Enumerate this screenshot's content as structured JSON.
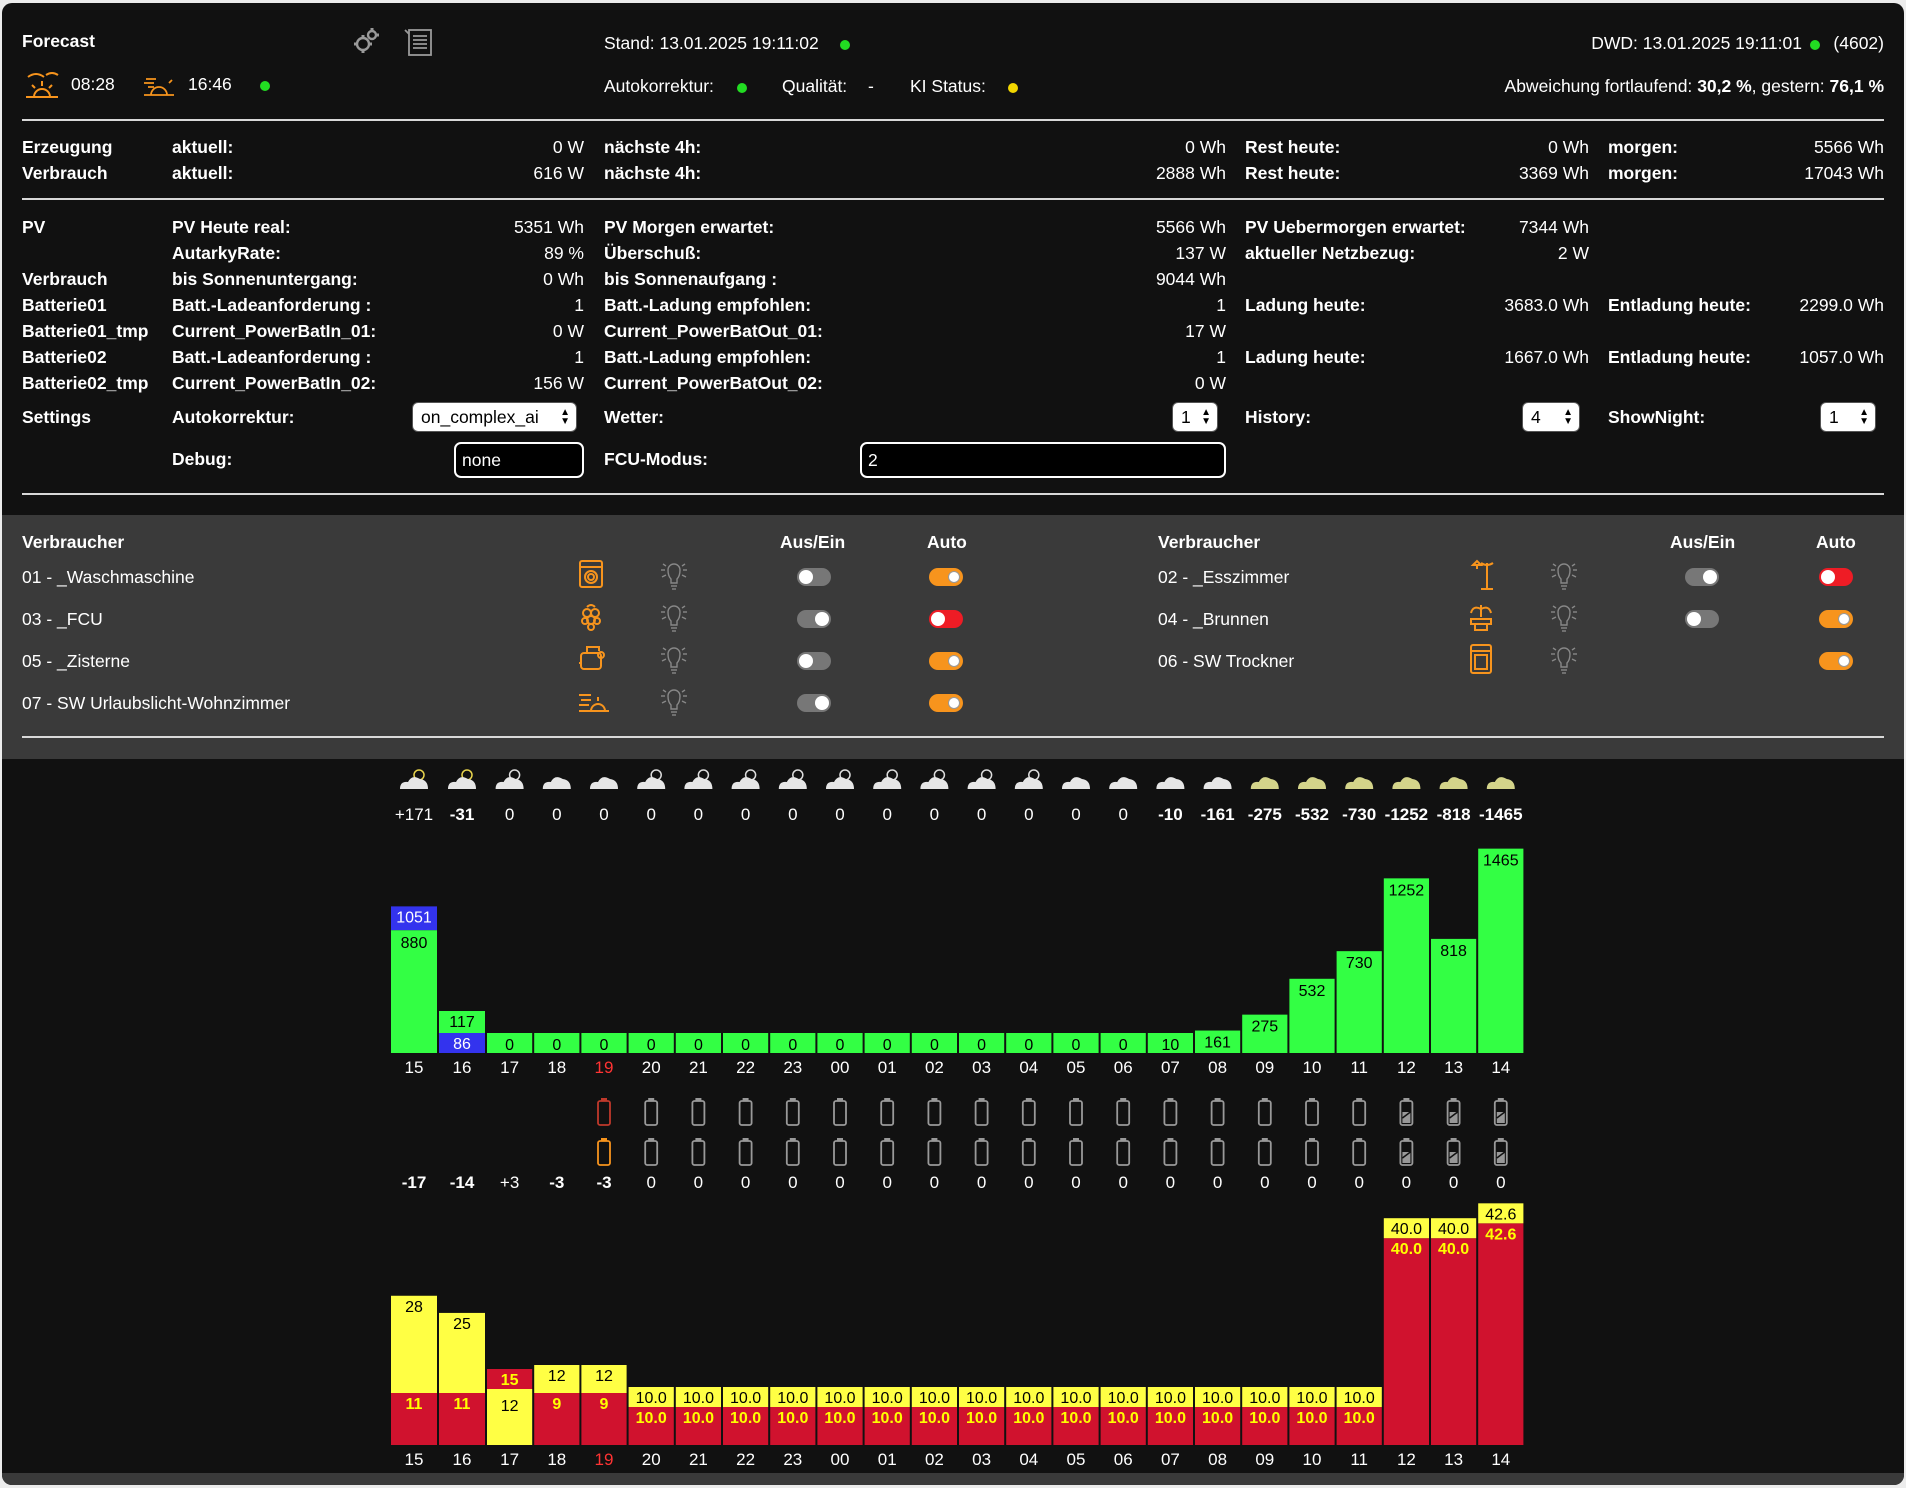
{
  "header": {
    "title": "Forecast",
    "sunrise": "08:28",
    "sunset": "16:46",
    "stand": "Stand: 13.01.2025 19:11:02",
    "dwd": "DWD: 13.01.2025 19:11:01",
    "dwd_count": "(4602)",
    "autokorrektur_label": "Autokorrektur:",
    "qualitaet_label": "Qualität:",
    "qualitaet_value": "-",
    "ki_status_label": "KI Status:",
    "abweichung_prefix": "Abweichung fortlaufend:",
    "abweichung_fortlaufend": "30,2 %",
    "gestern_prefix": ", gestern:",
    "abweichung_gestern": "76,1 %",
    "status_colors": {
      "sun": "#22dd22",
      "stand": "#22dd22",
      "dwd": "#22dd22",
      "autokorrektur": "#22dd22",
      "ki_status": "#f2d600"
    }
  },
  "summary": [
    {
      "label": "Erzeugung",
      "c1": "aktuell:",
      "v1": "0 W",
      "c2": "nächste 4h:",
      "v2": "0 Wh",
      "c3": "Rest heute:",
      "v3": "0 Wh",
      "c4": "morgen:",
      "v4": "5566 Wh"
    },
    {
      "label": "Verbrauch",
      "c1": "aktuell:",
      "v1": "616 W",
      "c2": "nächste 4h:",
      "v2": "2888 Wh",
      "c3": "Rest heute:",
      "v3": "3369 Wh",
      "c4": "morgen:",
      "v4": "17043 Wh"
    }
  ],
  "details": [
    {
      "label": "PV",
      "c1": "PV Heute real:",
      "v1": "5351 Wh",
      "c2": "PV Morgen erwartet:",
      "v2": "5566 Wh",
      "c3": "PV Uebermorgen erwartet:",
      "v3": "7344 Wh",
      "c4": "",
      "v4": ""
    },
    {
      "label": "",
      "c1": "AutarkyRate:",
      "v1": "89 %",
      "c2": "Überschuß:",
      "v2": "137 W",
      "c3": "aktueller Netzbezug:",
      "v3": "2 W",
      "c4": "",
      "v4": ""
    },
    {
      "label": "Verbrauch",
      "c1": "bis Sonnenuntergang:",
      "v1": "0 Wh",
      "c2": "bis Sonnenaufgang :",
      "v2": "9044 Wh",
      "c3": "",
      "v3": "",
      "c4": "",
      "v4": ""
    },
    {
      "label": "Batterie01",
      "c1": "Batt.-Ladeanforderung :",
      "v1": "1",
      "c2": "Batt.-Ladung empfohlen:",
      "v2": "1",
      "c3": "Ladung heute:",
      "v3": "3683.0 Wh",
      "c4": "Entladung heute:",
      "v4": "2299.0 Wh"
    },
    {
      "label": "Batterie01_tmp",
      "c1": "Current_PowerBatIn_01:",
      "v1": "0 W",
      "c2": "Current_PowerBatOut_01:",
      "v2": "17 W",
      "c3": "",
      "v3": "",
      "c4": "",
      "v4": ""
    },
    {
      "label": "Batterie02",
      "c1": "Batt.-Ladeanforderung :",
      "v1": "1",
      "c2": "Batt.-Ladung empfohlen:",
      "v2": "1",
      "c3": "Ladung heute:",
      "v3": "1667.0 Wh",
      "c4": "Entladung heute:",
      "v4": "1057.0 Wh"
    },
    {
      "label": "Batterie02_tmp",
      "c1": "Current_PowerBatIn_02:",
      "v1": "156 W",
      "c2": "Current_PowerBatOut_02:",
      "v2": "0 W",
      "c3": "",
      "v3": "",
      "c4": "",
      "v4": ""
    }
  ],
  "settings": {
    "label": "Settings",
    "autokorrektur_label": "Autokorrektur:",
    "autokorrektur_value": "on_complex_ai",
    "wetter_label": "Wetter:",
    "wetter_value": "1",
    "history_label": "History:",
    "history_value": "4",
    "shownight_label": "ShowNight:",
    "shownight_value": "1",
    "debug_label": "Debug:",
    "debug_value": "none",
    "fcu_label": "FCU-Modus:",
    "fcu_value": "2"
  },
  "consumers": {
    "header_name": "Verbraucher",
    "header_switch": "Aus/Ein",
    "header_auto": "Auto",
    "items": [
      {
        "name": "01 - _Waschmaschine",
        "icon": "washing-machine-icon",
        "switch": false,
        "auto": "auto-on"
      },
      {
        "name": "02 - _Esszimmer",
        "icon": "lamp-icon",
        "switch": true,
        "auto": "red"
      },
      {
        "name": "03 - _FCU",
        "icon": "raspberry-icon",
        "switch": true,
        "auto": "red"
      },
      {
        "name": "04 - _Brunnen",
        "icon": "fountain-icon",
        "switch": false,
        "auto": "auto-on"
      },
      {
        "name": "05 - _Zisterne",
        "icon": "pump-icon",
        "switch": false,
        "auto": "auto-on"
      },
      {
        "name": "06 - SW Trockner",
        "icon": "dryer-icon",
        "switch": null,
        "auto": "auto-on"
      },
      {
        "name": "07 - SW Urlaubslicht-Wohnzimmer",
        "icon": "light-scene-icon",
        "switch": true,
        "auto": "auto-on"
      }
    ]
  },
  "colors": {
    "accent": "#f7941d",
    "green_bar": "#33ff44",
    "blue_bar": "#3333ee",
    "yellow_bar": "#ffff44",
    "red_bar": "#d0122e",
    "highlight_hour": "#ff3333"
  },
  "chart_data": [
    {
      "type": "table",
      "name": "weather-and-deviation",
      "hours": [
        "15",
        "16",
        "17",
        "18",
        "19",
        "20",
        "21",
        "22",
        "23",
        "00",
        "01",
        "02",
        "03",
        "04",
        "05",
        "06",
        "07",
        "08",
        "09",
        "10",
        "11",
        "12",
        "13",
        "14"
      ],
      "weather_icons": [
        "sun-cloud",
        "sun-cloud",
        "sun-cloud",
        "cloud",
        "cloud",
        "sun-cloud",
        "sun-cloud",
        "sun-cloud",
        "sun-cloud",
        "sun-cloud",
        "sun-cloud",
        "sun-cloud",
        "sun-cloud",
        "sun-cloud",
        "cloud",
        "cloud",
        "cloud",
        "cloud",
        "cloud",
        "cloud",
        "cloud",
        "cloud",
        "cloud",
        "cloud"
      ],
      "deviation_labels": [
        "+171",
        "-31",
        "0",
        "0",
        "0",
        "0",
        "0",
        "0",
        "0",
        "0",
        "0",
        "0",
        "0",
        "0",
        "0",
        "0",
        "-10",
        "-161",
        "-275",
        "-532",
        "-730",
        "-1252",
        "-818",
        "-1465"
      ]
    },
    {
      "type": "bar",
      "name": "pv-forecast",
      "categories": [
        "15",
        "16",
        "17",
        "18",
        "19",
        "20",
        "21",
        "22",
        "23",
        "00",
        "01",
        "02",
        "03",
        "04",
        "05",
        "06",
        "07",
        "08",
        "09",
        "10",
        "11",
        "12",
        "13",
        "14"
      ],
      "series": [
        {
          "values": [
            880,
            117,
            0,
            0,
            0,
            0,
            0,
            0,
            0,
            0,
            0,
            0,
            0,
            0,
            0,
            0,
            10,
            161,
            275,
            532,
            730,
            1252,
            818,
            1465
          ]
        },
        {
          "values": [
            1051,
            86,
            null,
            null,
            null,
            null,
            null,
            null,
            null,
            null,
            null,
            null,
            null,
            null,
            null,
            null,
            null,
            null,
            null,
            null,
            null,
            null,
            null,
            null
          ]
        }
      ],
      "highlight_category": "19"
    },
    {
      "type": "table",
      "name": "battery-status",
      "hours": [
        "15",
        "16",
        "17",
        "18",
        "19",
        "20",
        "21",
        "22",
        "23",
        "00",
        "01",
        "02",
        "03",
        "04",
        "05",
        "06",
        "07",
        "08",
        "09",
        "10",
        "11",
        "12",
        "13",
        "14"
      ],
      "battery1": [
        "none",
        "none",
        "none",
        "none",
        "red",
        "empty",
        "empty",
        "empty",
        "empty",
        "empty",
        "empty",
        "empty",
        "empty",
        "empty",
        "empty",
        "empty",
        "empty",
        "empty",
        "empty",
        "empty",
        "empty",
        "charging",
        "charging",
        "charging"
      ],
      "battery2": [
        "none",
        "none",
        "none",
        "none",
        "orange",
        "empty",
        "empty",
        "empty",
        "empty",
        "empty",
        "empty",
        "empty",
        "empty",
        "empty",
        "empty",
        "empty",
        "empty",
        "empty",
        "empty",
        "empty",
        "empty",
        "charging",
        "charging",
        "charging"
      ],
      "values": [
        "-17",
        "-14",
        "+3",
        "-3",
        "-3",
        "0",
        "0",
        "0",
        "0",
        "0",
        "0",
        "0",
        "0",
        "0",
        "0",
        "0",
        "0",
        "0",
        "0",
        "0",
        "0",
        "0",
        "0",
        "0"
      ]
    },
    {
      "type": "bar",
      "name": "price-forecast",
      "categories": [
        "15",
        "16",
        "17",
        "18",
        "19",
        "20",
        "21",
        "22",
        "23",
        "00",
        "01",
        "02",
        "03",
        "04",
        "05",
        "06",
        "07",
        "08",
        "09",
        "10",
        "11",
        "12",
        "13",
        "14"
      ],
      "series": [
        {
          "values": [
            11,
            11,
            15,
            9,
            9,
            10.0,
            10.0,
            10.0,
            10.0,
            10.0,
            10.0,
            10.0,
            10.0,
            10.0,
            10.0,
            10.0,
            10.0,
            10.0,
            10.0,
            10.0,
            10.0,
            40.0,
            40.0,
            42.6
          ]
        },
        {
          "values": [
            28,
            25,
            12,
            12,
            12,
            10.0,
            10.0,
            10.0,
            10.0,
            10.0,
            10.0,
            10.0,
            10.0,
            10.0,
            10.0,
            10.0,
            10.0,
            10.0,
            10.0,
            10.0,
            10.0,
            40.0,
            40.0,
            42.6
          ]
        }
      ],
      "labels_red": [
        "11",
        "11",
        "15",
        "9",
        "9",
        "10.0",
        "10.0",
        "10.0",
        "10.0",
        "10.0",
        "10.0",
        "10.0",
        "10.0",
        "10.0",
        "10.0",
        "10.0",
        "10.0",
        "10.0",
        "10.0",
        "10.0",
        "10.0",
        "40.0",
        "40.0",
        "42.6"
      ],
      "labels_yellow": [
        "28",
        "25",
        "12",
        "12",
        "12",
        "10.0",
        "10.0",
        "10.0",
        "10.0",
        "10.0",
        "10.0",
        "10.0",
        "10.0",
        "10.0",
        "10.0",
        "10.0",
        "10.0",
        "10.0",
        "10.0",
        "10.0",
        "10.0",
        "40.0",
        "40.0",
        "42.6"
      ],
      "highlight_category": "19"
    }
  ]
}
